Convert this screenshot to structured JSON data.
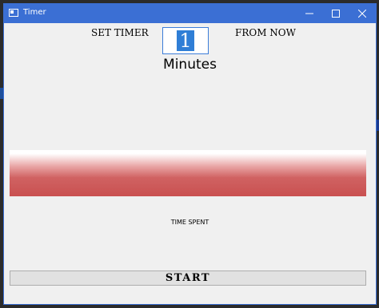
{
  "window": {
    "title": "Timer",
    "controls": {
      "minimize": "—",
      "maximize": "☐",
      "close": "✕"
    }
  },
  "timer": {
    "set_label": "SET TIMER",
    "minutes_value": "1",
    "from_label": "FROM NOW",
    "minutes_label": "Minutes"
  },
  "progress": {
    "time_spent_label": "TIME SPENT"
  },
  "actions": {
    "start_label": "START"
  },
  "colors": {
    "titlebar": "#3b6fd4",
    "progress_fill": "#c95050",
    "selection": "#2f7ed6"
  }
}
